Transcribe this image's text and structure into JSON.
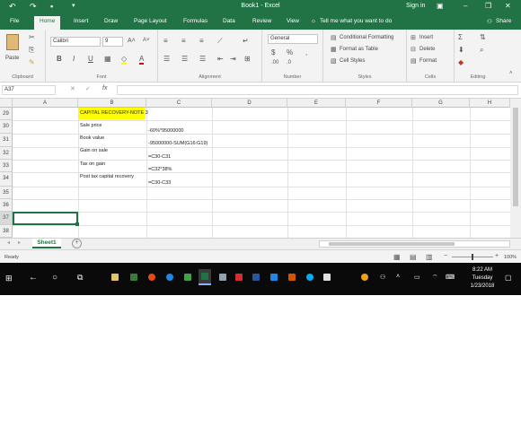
{
  "titlebar": {
    "title": "Book1 - Excel",
    "sign_in": "Sign in",
    "quick_access": [
      "undo-icon",
      "redo-icon",
      "save-icon",
      "customize-icon"
    ]
  },
  "tabs": {
    "items": [
      "File",
      "Home",
      "Insert",
      "Draw",
      "Page Layout",
      "Formulas",
      "Data",
      "Review",
      "View"
    ],
    "active": "Home",
    "tell_me": "Tell me what you want to do",
    "share": "Share"
  },
  "ribbon": {
    "clipboard": {
      "label": "Clipboard",
      "paste": "Paste"
    },
    "font": {
      "label": "Font",
      "name": "Calibri",
      "size": "9"
    },
    "alignment": {
      "label": "Alignment"
    },
    "number": {
      "label": "Number",
      "format": "General"
    },
    "styles": {
      "label": "Styles",
      "conditional": "Conditional Formatting",
      "table": "Format as Table",
      "cell_styles": "Cell Styles"
    },
    "cells": {
      "label": "Cells",
      "insert": "Insert",
      "delete": "Delete",
      "format": "Format"
    },
    "editing": {
      "label": "Editing"
    }
  },
  "formula_bar": {
    "name_box": "A37",
    "fx": "fx",
    "value": ""
  },
  "grid": {
    "columns": [
      "A",
      "B",
      "C",
      "D",
      "E",
      "F",
      "G",
      "H"
    ],
    "rows": [
      "29",
      "30",
      "31",
      "32",
      "33",
      "34",
      "35",
      "36",
      "37",
      "38"
    ],
    "cells": {
      "B29": "CAPITAL RECOVERY-NOTE 3",
      "B30": "Sale price",
      "B31": "Book value",
      "B32": "Gain on sale",
      "B33": "Tax on gain",
      "B34": "Post tax capital recovery",
      "C30": "-60%*95000000",
      "C31": "-95000000-SUM(G16:G19)",
      "C32": "=C30-C31",
      "C33": "=C32*38%",
      "C34": "=C30-C33"
    },
    "highlight_color": "#ffff00",
    "selected_cell": "A37"
  },
  "sheet_tabs": {
    "active": "Sheet1"
  },
  "status": {
    "text": "Ready",
    "zoom": "100%"
  },
  "taskbar": {
    "time": "8:22 AM",
    "day": "Tuesday",
    "date": "1/23/2018"
  },
  "colors": {
    "excel_green": "#217346",
    "taskbar": "#0a0a0a"
  }
}
